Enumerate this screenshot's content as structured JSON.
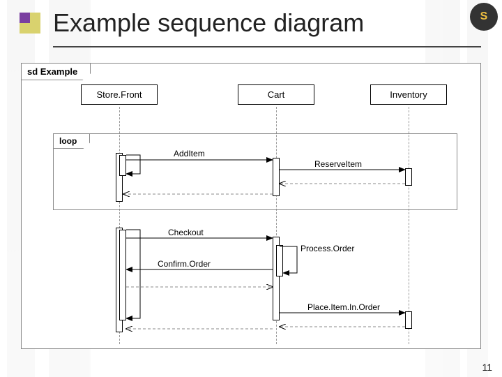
{
  "slide": {
    "title": "Example sequence diagram",
    "page_number": "11",
    "logo_letter": "S"
  },
  "diagram": {
    "frame_label": "sd Example",
    "fragment_label": "loop",
    "lifelines": {
      "storefront": "Store.Front",
      "cart": "Cart",
      "inventory": "Inventory"
    },
    "messages": {
      "add_item": "AddItem",
      "reserve_item": "ReserveItem",
      "checkout": "Checkout",
      "process_order": "Process.Order",
      "confirm_order": "Confirm.Order",
      "place_item": "Place.Item.In.Order"
    }
  }
}
